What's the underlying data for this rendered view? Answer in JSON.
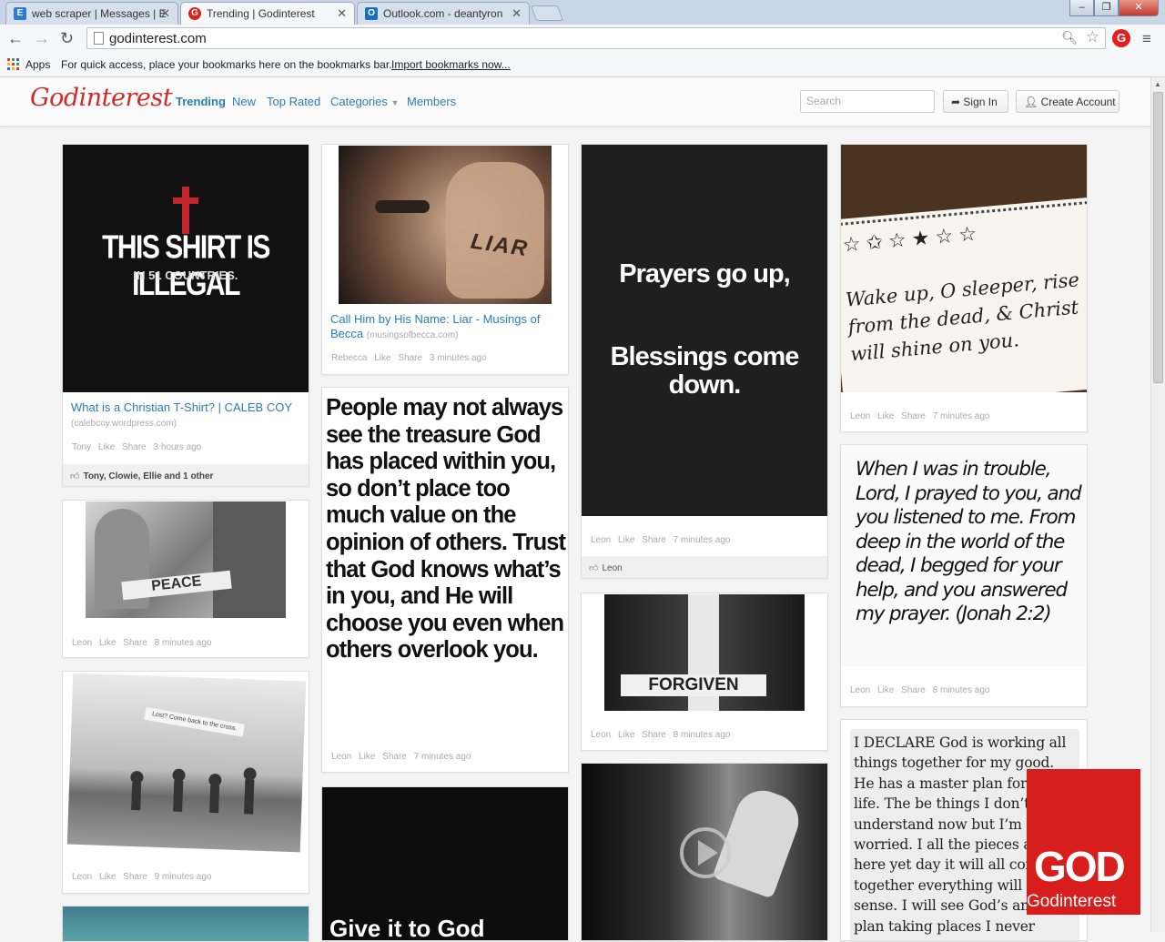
{
  "browser": {
    "tabs": [
      {
        "title": "web scraper | Messages | E",
        "favicon": "E"
      },
      {
        "title": "Trending | Godinterest",
        "favicon": "G"
      },
      {
        "title": "Outlook.com - deantyron",
        "favicon": "O"
      }
    ],
    "url": "godinterest.com",
    "bookmarks_apps": "Apps",
    "bookmarks_message": "For quick access, place your bookmarks here on the bookmarks bar.",
    "bookmarks_link": "Import bookmarks now..."
  },
  "site": {
    "logo": "Godinterest",
    "nav": [
      "Trending",
      "New",
      "Top Rated",
      "Categories",
      "Members"
    ],
    "search_placeholder": "Search",
    "sign_in": "Sign In",
    "create_account": "Create Account"
  },
  "cards": {
    "c1": {
      "image_line1": "THIS SHIRT IS ILLEGAL",
      "image_line2": "IN 51 COUNTRIES.",
      "title": "What is a Christian T-Shirt? | CALEB COY",
      "source": "(calebcoy.wordpress.com)",
      "user": "Tony",
      "like": "Like",
      "share": "Share",
      "time": "3 hours ago",
      "likers": "Tony, Clowie, Ellie",
      "likers_more": "and 1 other"
    },
    "c2": {
      "image_label": "PEACE",
      "user": "Leon",
      "like": "Like",
      "share": "Share",
      "time": "8 minutes ago"
    },
    "c3": {
      "image_label": "Lost? Come back to the cross.",
      "user": "Leon",
      "like": "Like",
      "share": "Share",
      "time": "9 minutes ago"
    },
    "c4": {
      "image_label": "LIAR",
      "title": "Call Him by His Name: Liar - Musings of Becca",
      "source": "(musingsofbecca.com)",
      "user": "Rebecca",
      "like": "Like",
      "share": "Share",
      "time": "3 minutes ago"
    },
    "c5": {
      "quote": "People may not always see the treasure God has placed within you, so don’t place too much value on the opinion of others. Trust that God knows what’s in you, and He will choose you even when others overlook you.",
      "user": "Leon",
      "like": "Like",
      "share": "Share",
      "time": "7 minutes ago"
    },
    "c6": {
      "image_text": "Give it to God"
    },
    "c7": {
      "quote1": "Prayers go up,",
      "quote2": "Blessings come down.",
      "user": "Leon",
      "like": "Like",
      "share": "Share",
      "time": "7 minutes ago",
      "liker": "Leon"
    },
    "c8": {
      "image_label": "FORGIVEN",
      "user": "Leon",
      "like": "Like",
      "share": "Share",
      "time": "8 minutes ago"
    },
    "c10": {
      "quote": "Wake up, O sleeper, rise from the dead, & Christ will shine on you.",
      "user": "Leon",
      "like": "Like",
      "share": "Share",
      "time": "7 minutes ago"
    },
    "c11": {
      "quote": "When I was in trouble, Lord, I prayed to you, and you listened to me. From deep in the world of the dead, I begged for your help, and you answered my prayer. (Jonah 2:2)",
      "user": "Leon",
      "like": "Like",
      "share": "Share",
      "time": "8 minutes ago"
    },
    "c12": {
      "quote": "I DECLARE God is working all things together for my good. He has a master plan for my life. The be things I don’t understand now but I’m not worried. I all the pieces aren’t here yet day it will all come together everything will make sense. I will see God’s amazing plan taking places I never dreamed of. This is"
    }
  },
  "overlay": {
    "logo_text": "GOD",
    "logo_sub": "Godinterest"
  }
}
